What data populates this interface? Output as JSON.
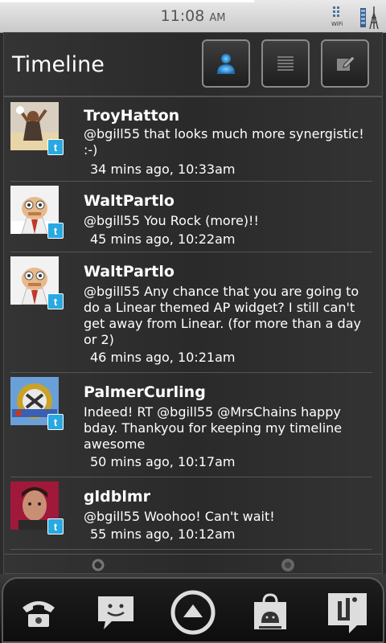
{
  "status_bar": {
    "time": "11:08",
    "ampm": "AM",
    "wifi_label": "WiFi"
  },
  "header": {
    "title": "Timeline",
    "buttons": [
      {
        "icon": "person-icon",
        "label": ""
      },
      {
        "icon": "list-icon",
        "label": ""
      },
      {
        "icon": "compose-icon",
        "label": ""
      }
    ]
  },
  "tweets": [
    {
      "user": "TroyHatton",
      "text": "@bgill55 that looks much more synergistic! :-)",
      "time": "34 mins ago, 10:33am"
    },
    {
      "user": "WaltPartlo",
      "text": "@bgill55 You Rock (more)!!",
      "time": "45 mins ago, 10:22am"
    },
    {
      "user": "WaltPartlo",
      "text": "@bgill55 Any chance that you are going to do a Linear themed AP widget?  I still can't get away from Linear. (for more than a day or 2)",
      "time": "46 mins ago, 10:21am"
    },
    {
      "user": "PalmerCurling",
      "text": "Indeed! RT @bgill55 @MrsChains happy bday.  Thankyou for keeping my timeline awesome",
      "time": "50 mins ago, 10:17am"
    },
    {
      "user": "gldblmr",
      "text": "@bgill55 Woohoo! Can't wait!",
      "time": "55 mins ago, 10:12am"
    }
  ],
  "badge_letter": "t",
  "dock": [
    "phone-icon",
    "messaging-icon",
    "launcher-icon",
    "market-icon",
    "app-icon"
  ],
  "colors": {
    "twitter_blue": "#29a9e1",
    "background": "#2b2b2b"
  }
}
